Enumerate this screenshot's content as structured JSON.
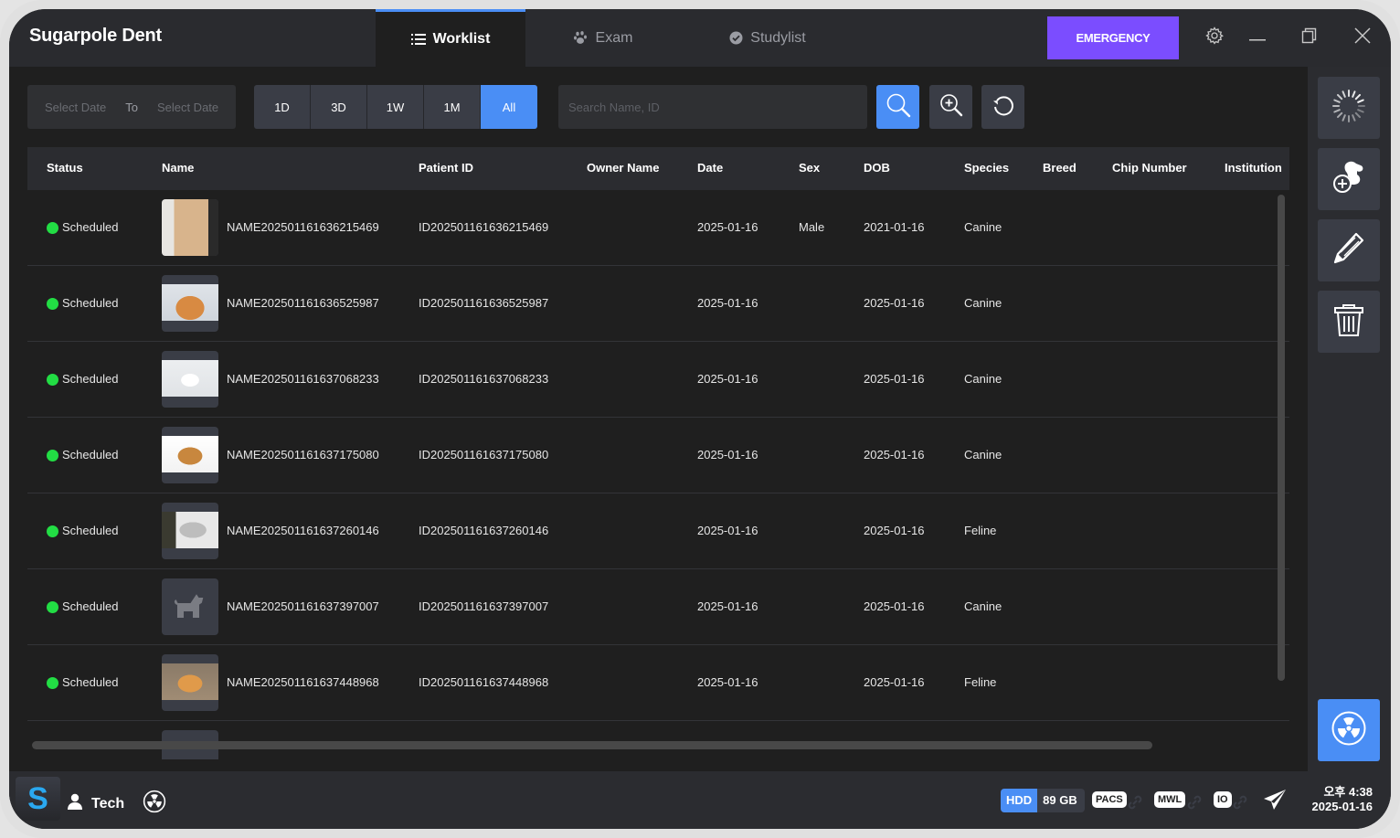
{
  "app": {
    "title": "Sugarpole Dent"
  },
  "tabs": [
    {
      "label": "Worklist",
      "icon": "list-icon",
      "active": true
    },
    {
      "label": "Exam",
      "icon": "paw-icon",
      "active": false
    },
    {
      "label": "Studylist",
      "icon": "check-circle-icon",
      "active": false
    }
  ],
  "header": {
    "emergency_label": "EMERGENCY"
  },
  "toolbar": {
    "date_from_placeholder": "Select Date",
    "date_to_label": "To",
    "date_to_placeholder": "Select Date",
    "periods": [
      "1D",
      "3D",
      "1W",
      "1M",
      "All"
    ],
    "active_period": "All",
    "search_placeholder": "Search Name, ID",
    "search_value": ""
  },
  "table": {
    "columns": [
      "Status",
      "Name",
      "Patient ID",
      "Owner Name",
      "Date",
      "Sex",
      "DOB",
      "Species",
      "Breed",
      "Chip Number",
      "Institution"
    ],
    "rows": [
      {
        "status": "Scheduled",
        "thumb": "photo-pomeranian",
        "name": "NAME202501161636215469",
        "patient_id": "ID202501161636215469",
        "owner": "",
        "date": "2025-01-16",
        "sex": "Male",
        "dob": "2021-01-16",
        "species": "Canine",
        "breed": "",
        "chip": "",
        "institution": ""
      },
      {
        "status": "Scheduled",
        "thumb": "photo-corgi",
        "name": "NAME202501161636525987",
        "patient_id": "ID202501161636525987",
        "owner": "",
        "date": "2025-01-16",
        "sex": "",
        "dob": "2025-01-16",
        "species": "Canine",
        "breed": "",
        "chip": "",
        "institution": ""
      },
      {
        "status": "Scheduled",
        "thumb": "photo-white-dog",
        "name": "NAME202501161637068233",
        "patient_id": "ID202501161637068233",
        "owner": "",
        "date": "2025-01-16",
        "sex": "",
        "dob": "2025-01-16",
        "species": "Canine",
        "breed": "",
        "chip": "",
        "institution": ""
      },
      {
        "status": "Scheduled",
        "thumb": "photo-golden-retriever",
        "name": "NAME202501161637175080",
        "patient_id": "ID202501161637175080",
        "owner": "",
        "date": "2025-01-16",
        "sex": "",
        "dob": "2025-01-16",
        "species": "Canine",
        "breed": "",
        "chip": "",
        "institution": ""
      },
      {
        "status": "Scheduled",
        "thumb": "photo-tabby-cat",
        "name": "NAME202501161637260146",
        "patient_id": "ID202501161637260146",
        "owner": "",
        "date": "2025-01-16",
        "sex": "",
        "dob": "2025-01-16",
        "species": "Feline",
        "breed": "",
        "chip": "",
        "institution": ""
      },
      {
        "status": "Scheduled",
        "thumb": "dog-placeholder-icon",
        "name": "NAME202501161637397007",
        "patient_id": "ID202501161637397007",
        "owner": "",
        "date": "2025-01-16",
        "sex": "",
        "dob": "2025-01-16",
        "species": "Canine",
        "breed": "",
        "chip": "",
        "institution": ""
      },
      {
        "status": "Scheduled",
        "thumb": "photo-orange-cat",
        "name": "NAME202501161637448968",
        "patient_id": "ID202501161637448968",
        "owner": "",
        "date": "2025-01-16",
        "sex": "",
        "dob": "2025-01-16",
        "species": "Feline",
        "breed": "",
        "chip": "",
        "institution": ""
      }
    ]
  },
  "side_actions": [
    "loading-spinner-icon",
    "add-patient-icon",
    "edit-pencil-icon",
    "trash-icon",
    "radiation-icon"
  ],
  "footer": {
    "logo_letter": "S",
    "user_name": "Tech",
    "hdd_label": "HDD",
    "hdd_free": "89 GB",
    "pacs_label": "PACS",
    "mwl_label": "MWL",
    "io_label": "IO",
    "time": "오후 4:38",
    "date": "2025-01-16"
  },
  "colors": {
    "accent": "#4a8ef5",
    "emergency": "#7b4dff",
    "status_scheduled": "#22dd44",
    "logo": "#2aa8f0"
  }
}
